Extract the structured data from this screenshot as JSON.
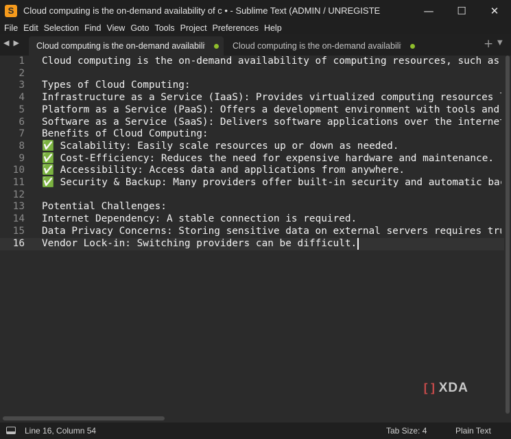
{
  "window": {
    "title": "Cloud computing is the on-demand availability of c • - Sublime Text (ADMIN / UNREGISTERED)",
    "app_icon_letter": "S",
    "minimize": "—",
    "maximize": "☐",
    "close": "✕"
  },
  "menu": [
    "File",
    "Edit",
    "Selection",
    "Find",
    "View",
    "Goto",
    "Tools",
    "Project",
    "Preferences",
    "Help"
  ],
  "tabs": {
    "nav_left": "◀",
    "nav_right": "▶",
    "items": [
      {
        "label": "Cloud computing is the on-demand availability of c",
        "active": true,
        "dirty": true
      },
      {
        "label": "Cloud computing is the on-demand availability of c",
        "active": false,
        "dirty": true
      }
    ],
    "add": "+",
    "more": "▼"
  },
  "editor": {
    "current_line": 16,
    "lines": [
      {
        "num": "1",
        "text": "Cloud computing is the on-demand availability of computing resources, such as storage"
      },
      {
        "num": "2",
        "text": ""
      },
      {
        "num": "3",
        "text": "Types of Cloud Computing:"
      },
      {
        "num": "4",
        "text": "Infrastructure as a Service (IaaS): Provides virtualized computing resources like serv"
      },
      {
        "num": "5",
        "text": "Platform as a Service (PaaS): Offers a development environment with tools and services"
      },
      {
        "num": "6",
        "text": "Software as a Service (SaaS): Delivers software applications over the internet without"
      },
      {
        "num": "7",
        "text": "Benefits of Cloud Computing:"
      },
      {
        "num": "8",
        "text": "✅ Scalability: Easily scale resources up or down as needed."
      },
      {
        "num": "9",
        "text": "✅ Cost-Efficiency: Reduces the need for expensive hardware and maintenance."
      },
      {
        "num": "10",
        "text": "✅ Accessibility: Access data and applications from anywhere."
      },
      {
        "num": "11",
        "text": "✅ Security & Backup: Many providers offer built-in security and automatic backups."
      },
      {
        "num": "12",
        "text": ""
      },
      {
        "num": "13",
        "text": "Potential Challenges:"
      },
      {
        "num": "14",
        "text": "Internet Dependency: A stable connection is required."
      },
      {
        "num": "15",
        "text": "Data Privacy Concerns: Storing sensitive data on external servers requires trust in pr"
      },
      {
        "num": "16",
        "text": "Vendor Lock-in: Switching providers can be difficult."
      }
    ]
  },
  "watermark": {
    "bracket": "[]",
    "text": "XDA"
  },
  "status": {
    "position": "Line 16, Column 54",
    "tab_size": "Tab Size: 4",
    "syntax": "Plain Text"
  },
  "colors": {
    "background": "#2b2b2b",
    "chrome": "#1f1f1f",
    "dirty_dot": "#8fbe2c",
    "icon_orange": "#f59a1c",
    "checkmark_green": "#3fb950"
  }
}
